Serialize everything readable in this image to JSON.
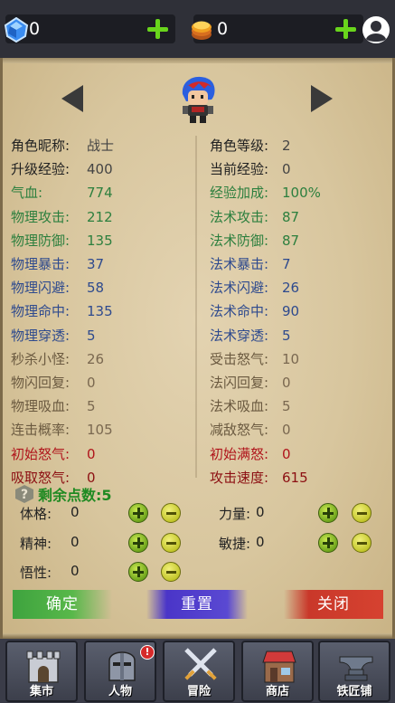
{
  "resources": {
    "gem_value": "0",
    "coin_value": "0",
    "gem_icon": "blue-gem-icon",
    "coin_icon": "gold-coin-icon"
  },
  "stats": {
    "left": [
      {
        "label": "角色昵称:",
        "value": "战士",
        "color": "black"
      },
      {
        "label": "升级经验:",
        "value": "400",
        "color": "black"
      },
      {
        "label": "气血:",
        "value": "774",
        "color": "green"
      },
      {
        "label": "物理攻击:",
        "value": "212",
        "color": "green"
      },
      {
        "label": "物理防御:",
        "value": "135",
        "color": "green"
      },
      {
        "label": "物理暴击:",
        "value": "37",
        "color": "blue"
      },
      {
        "label": "物理闪避:",
        "value": "58",
        "color": "blue"
      },
      {
        "label": "物理命中:",
        "value": "135",
        "color": "blue"
      },
      {
        "label": "物理穿透:",
        "value": "5",
        "color": "blue"
      },
      {
        "label": "秒杀小怪:",
        "value": "26",
        "color": "brown"
      },
      {
        "label": "物闪回复:",
        "value": "0",
        "color": "brown"
      },
      {
        "label": "物理吸血:",
        "value": "5",
        "color": "brown"
      },
      {
        "label": "连击概率:",
        "value": "105",
        "color": "brown"
      },
      {
        "label": "初始怒气:",
        "value": "0",
        "color": "red"
      },
      {
        "label": "吸取怒气:",
        "value": "0",
        "color": "darkred"
      }
    ],
    "right": [
      {
        "label": "角色等级:",
        "value": "2",
        "color": "black"
      },
      {
        "label": "当前经验:",
        "value": "0",
        "color": "black"
      },
      {
        "label": "经验加成:",
        "value": "100%",
        "color": "green"
      },
      {
        "label": "法术攻击:",
        "value": "87",
        "color": "green"
      },
      {
        "label": "法术防御:",
        "value": "87",
        "color": "green"
      },
      {
        "label": "法术暴击:",
        "value": "7",
        "color": "blue"
      },
      {
        "label": "法术闪避:",
        "value": "26",
        "color": "blue"
      },
      {
        "label": "法术命中:",
        "value": "90",
        "color": "blue"
      },
      {
        "label": "法术穿透:",
        "value": "5",
        "color": "blue"
      },
      {
        "label": "受击怒气:",
        "value": "10",
        "color": "brown"
      },
      {
        "label": "法闪回复:",
        "value": "0",
        "color": "brown"
      },
      {
        "label": "法术吸血:",
        "value": "5",
        "color": "brown"
      },
      {
        "label": "减敌怒气:",
        "value": "0",
        "color": "brown"
      },
      {
        "label": "初始满怒:",
        "value": "0",
        "color": "red"
      },
      {
        "label": "攻击速度:",
        "value": "615",
        "color": "darkred"
      }
    ]
  },
  "points": {
    "label": "剩余点数:5"
  },
  "attributes": [
    {
      "label": "体格:",
      "value": "0"
    },
    {
      "label": "力量:",
      "value": "0"
    },
    {
      "label": "精神:",
      "value": "0"
    },
    {
      "label": "敏捷:",
      "value": "0"
    },
    {
      "label": "悟性:",
      "value": "0"
    }
  ],
  "actions": {
    "confirm": "确定",
    "reset": "重置",
    "close": "关闭"
  },
  "nav": [
    {
      "label": "集市",
      "icon": "castle-icon"
    },
    {
      "label": "人物",
      "icon": "knight-helmet-icon",
      "badge": "!"
    },
    {
      "label": "冒险",
      "icon": "crossed-swords-icon"
    },
    {
      "label": "商店",
      "icon": "shop-icon"
    },
    {
      "label": "铁匠铺",
      "icon": "anvil-icon"
    }
  ],
  "colors": {
    "green": "#2c7f3e",
    "blue": "#2e4a8e",
    "brown": "#6b5a40",
    "red": "#b0141b",
    "darkred": "#8c0f12",
    "black": "#222222"
  }
}
